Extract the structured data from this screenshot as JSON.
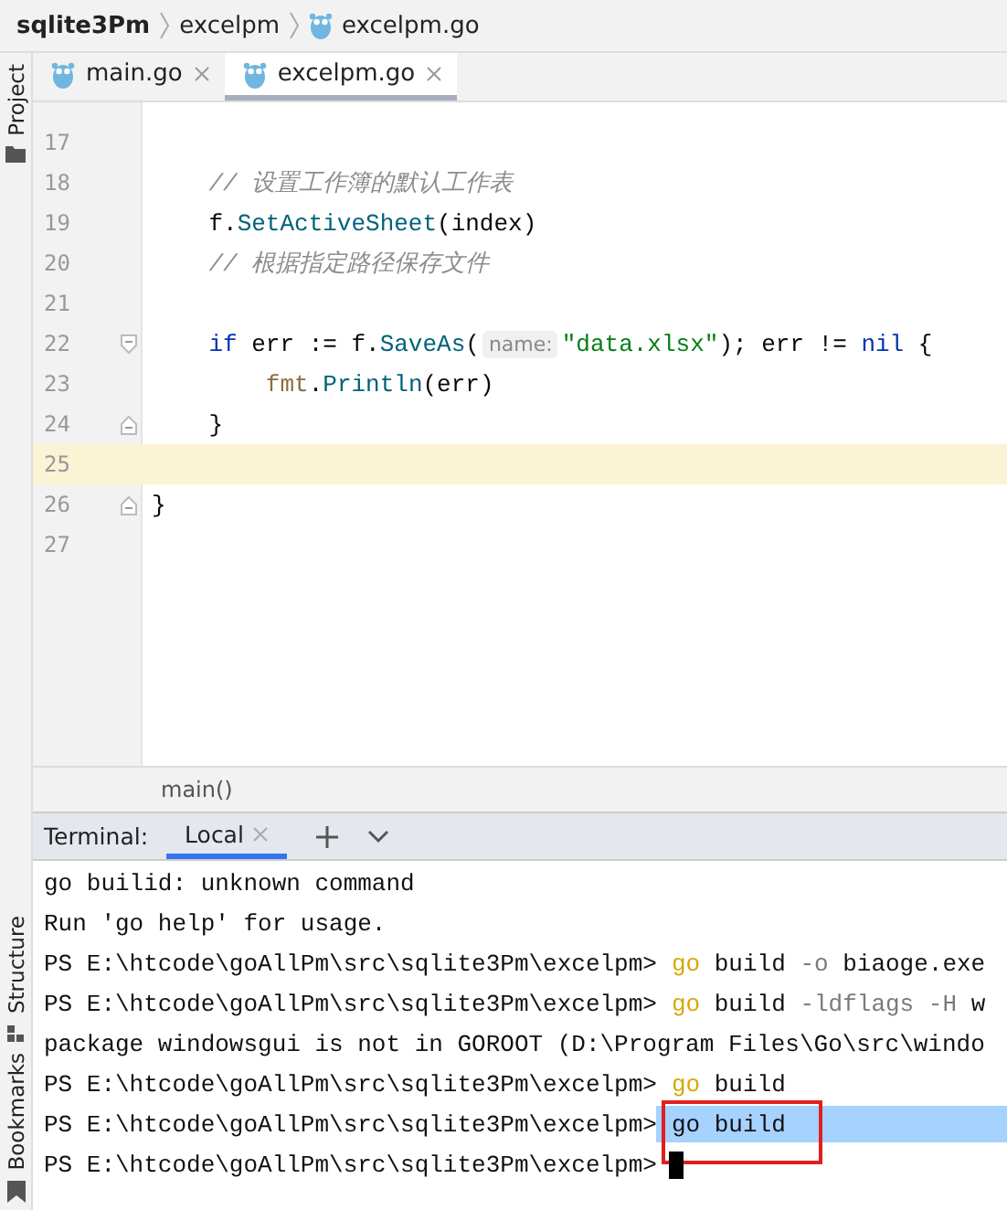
{
  "breadcrumb": [
    {
      "label": "sqlite3Pm",
      "kind": "project"
    },
    {
      "label": "excelpm",
      "kind": "folder"
    },
    {
      "label": "excelpm.go",
      "kind": "file"
    }
  ],
  "tool_windows": {
    "left_top": [
      {
        "label": "Project",
        "kind": "folder"
      }
    ],
    "left_bottom": [
      {
        "label": "Structure",
        "kind": "structure"
      },
      {
        "label": "Bookmarks",
        "kind": "bookmark"
      }
    ]
  },
  "tabs": [
    {
      "label": "main.go",
      "selected": false
    },
    {
      "label": "excelpm.go",
      "selected": true
    }
  ],
  "editor": {
    "lines": [
      {
        "number": "17",
        "current": false,
        "kind": "plain"
      },
      {
        "number": "18",
        "current": false,
        "kind": "plain",
        "tokens": [
          {
            "kind": "comment",
            "text": "    // 设置工作簿的默认工作表"
          }
        ]
      },
      {
        "number": "19",
        "current": false,
        "kind": "plain",
        "tokens": [
          {
            "kind": "text",
            "text": "    f."
          },
          {
            "kind": "call",
            "text": "SetActiveSheet"
          },
          {
            "kind": "text",
            "text": "(index)"
          }
        ]
      },
      {
        "number": "20",
        "current": false,
        "kind": "plain",
        "tokens": [
          {
            "kind": "comment",
            "text": "    // 根据指定路径保存文件"
          }
        ]
      },
      {
        "number": "21",
        "current": false,
        "kind": "plain"
      },
      {
        "number": "22",
        "current": false,
        "kind": "fold-start",
        "tokens": [
          {
            "kind": "keyword",
            "text": "    if"
          },
          {
            "kind": "text",
            "text": " err := f."
          },
          {
            "kind": "call",
            "text": "SaveAs"
          },
          {
            "kind": "text",
            "text": "("
          },
          {
            "kind": "hint",
            "text": "name:"
          },
          {
            "kind": "string",
            "text": "\"data.xlsx\""
          },
          {
            "kind": "text",
            "text": "); err != "
          },
          {
            "kind": "keyword",
            "text": "nil"
          },
          {
            "kind": "text",
            "text": " {"
          }
        ]
      },
      {
        "number": "23",
        "current": false,
        "kind": "plain",
        "tokens": [
          {
            "kind": "package",
            "text": "        fmt"
          },
          {
            "kind": "text",
            "text": "."
          },
          {
            "kind": "call",
            "text": "Println"
          },
          {
            "kind": "text",
            "text": "(err)"
          }
        ]
      },
      {
        "number": "24",
        "current": false,
        "kind": "fold-end",
        "tokens": [
          {
            "kind": "text",
            "text": "    }"
          }
        ]
      },
      {
        "number": "25",
        "current": true,
        "kind": "plain"
      },
      {
        "number": "26",
        "current": false,
        "kind": "fold-end",
        "tokens": [
          {
            "kind": "text",
            "text": "}"
          }
        ]
      },
      {
        "number": "27",
        "current": false,
        "kind": "plain"
      }
    ],
    "breadcrumb": "main()"
  },
  "terminal": {
    "title": "Terminal:",
    "tabs": [
      {
        "label": "Local",
        "selected": true
      }
    ],
    "lines": [
      {
        "selected": false,
        "tokens": [
          {
            "kind": "text",
            "text": "go builid: unknown command"
          }
        ]
      },
      {
        "selected": false,
        "tokens": [
          {
            "kind": "text",
            "text": "Run 'go help' for usage."
          }
        ]
      },
      {
        "selected": false,
        "prompt": "PS E:\\htcode\\goAllPm\\src\\sqlite3Pm\\excelpm>",
        "tokens": [
          {
            "kind": "command",
            "text": "go"
          },
          {
            "kind": "text",
            "text": " build "
          },
          {
            "kind": "flag",
            "text": "-o"
          },
          {
            "kind": "text",
            "text": " biaoge.exe"
          }
        ]
      },
      {
        "selected": false,
        "prompt": "PS E:\\htcode\\goAllPm\\src\\sqlite3Pm\\excelpm>",
        "tokens": [
          {
            "kind": "command",
            "text": "go"
          },
          {
            "kind": "text",
            "text": " build "
          },
          {
            "kind": "flag",
            "text": "-ldflags -H"
          },
          {
            "kind": "text",
            "text": " w"
          }
        ]
      },
      {
        "selected": false,
        "tokens": [
          {
            "kind": "text",
            "text": "package windowsgui is not in GOROOT (D:\\Program Files\\Go\\src\\windo"
          }
        ]
      },
      {
        "selected": false,
        "prompt": "PS E:\\htcode\\goAllPm\\src\\sqlite3Pm\\excelpm>",
        "tokens": [
          {
            "kind": "command",
            "text": "go"
          },
          {
            "kind": "text",
            "text": " build"
          }
        ]
      },
      {
        "selected": true,
        "boxed": true,
        "prompt": "PS E:\\htcode\\goAllPm\\src\\sqlite3Pm\\excelpm>",
        "tokens": [
          {
            "kind": "text",
            "text": "go build"
          }
        ]
      },
      {
        "selected": false,
        "cursor": true,
        "prompt": "PS E:\\htcode\\goAllPm\\src\\sqlite3Pm\\excelpm>"
      }
    ]
  }
}
